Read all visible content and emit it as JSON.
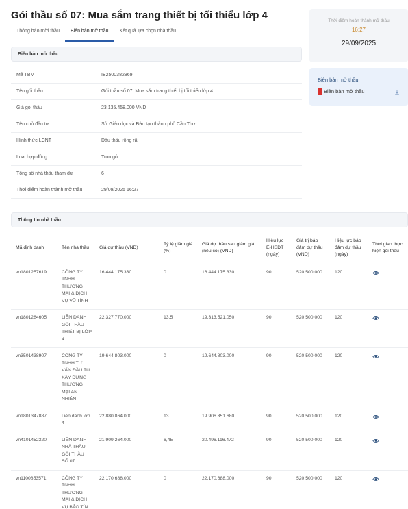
{
  "page_title": "Gói thầu số 07: Mua sắm trang thiết bị tối thiểu lớp 4",
  "tabs": [
    {
      "label": "Thông báo mời thầu"
    },
    {
      "label": "Biên bản mở thầu"
    },
    {
      "label": "Kết quả lựa chọn nhà thầu"
    }
  ],
  "opening_record": {
    "section_title": "Biên bản mở thầu",
    "rows": [
      {
        "label": "Mã TBMT",
        "value": "IB2500382869"
      },
      {
        "label": "Tên gói thầu",
        "value": "Gói thầu số 07: Mua sắm trang thiết bị tối thiểu lớp 4"
      },
      {
        "label": "Giá gói thầu",
        "value": "23.135.458.000 VND"
      },
      {
        "label": "Tên chủ đầu tư",
        "value": "Sở Giáo dục và Đào tạo thành phố Cần Thơ"
      },
      {
        "label": "Hình thức LCNT",
        "value": "Đấu thầu rộng rãi"
      },
      {
        "label": "Loại hợp đồng",
        "value": "Trọn gói"
      },
      {
        "label": "Tổng số nhà thầu tham dự",
        "value": "6"
      },
      {
        "label": "Thời điểm hoàn thành mở thầu",
        "value": "29/09/2025 16:27"
      }
    ]
  },
  "completion_card": {
    "label": "Thời điểm hoàn thành mở thầu",
    "time": "16:27",
    "date": "29/09/2025"
  },
  "file_card": {
    "title": "Biên bản mở thầu",
    "file_name": "Biên bản mở thầu",
    "file_icon": "pdf-icon",
    "download_icon": "download-icon"
  },
  "contractors": {
    "section_title": "Thông tin nhà thầu",
    "headers": [
      "Mã định danh",
      "Tên nhà thầu",
      "Giá dự thầu (VND)",
      "Tỷ lệ giảm giá (%)",
      "Giá dự thầu sau giảm giá (nếu có) (VND)",
      "Hiệu lực E-HSDT (ngày)",
      "Giá trị bảo đảm dự thầu (VND)",
      "Hiệu lực bảo đảm dự thầu (ngày)",
      "Thời gian thực hiện gói thầu"
    ],
    "rows": [
      {
        "id": "vn1801257619",
        "name": "CÔNG TY TNHH THƯƠNG MẠI & DỊCH VỤ VŨ TÍNH",
        "price": "16.444.175.330",
        "discount": "0",
        "after": "16.444.175.330",
        "validity": "90",
        "guarantee": "520.500.000",
        "guarantee_validity": "120"
      },
      {
        "id": "vn1801284605",
        "name": "LIÊN DANH GÓI THẦU THIẾT BỊ LỚP 4",
        "price": "22.327.770.000",
        "discount": "13,5",
        "after": "19.313.521.050",
        "validity": "90",
        "guarantee": "520.500.000",
        "guarantee_validity": "120"
      },
      {
        "id": "vn3501438907",
        "name": "CÔNG TY TNHH TƯ VẤN ĐẦU TƯ XÂY DỰNG THƯƠNG MẠI AN NHIÊN",
        "price": "19.644.803.000",
        "discount": "0",
        "after": "19.644.803.000",
        "validity": "90",
        "guarantee": "520.500.000",
        "guarantee_validity": "120"
      },
      {
        "id": "vn1801347887",
        "name": "Liên danh lớp 4",
        "price": "22.880.864.000",
        "discount": "13",
        "after": "19.906.351.680",
        "validity": "90",
        "guarantee": "520.500.000",
        "guarantee_validity": "120"
      },
      {
        "id": "vn4101452320",
        "name": "LIÊN DANH NHÀ THẦU GÓI THẦU SỐ 07",
        "price": "21.909.264.000",
        "discount": "6,45",
        "after": "20.496.116.472",
        "validity": "90",
        "guarantee": "520.500.000",
        "guarantee_validity": "120"
      },
      {
        "id": "vn1100853571",
        "name": "CÔNG TY TNHH THƯƠNG MẠI & DỊCH VỤ BẢO TÍN",
        "price": "22.170.688.000",
        "discount": "0",
        "after": "22.170.688.000",
        "validity": "90",
        "guarantee": "520.500.000",
        "guarantee_validity": "120"
      }
    ],
    "view_icon": "eye-icon"
  },
  "colors": {
    "accent": "#2b5ca8",
    "time_orange": "#c9892d",
    "pdf_red": "#d9322f",
    "card_bg": "#f3f5f8",
    "file_card_bg": "#eaf1fb"
  }
}
